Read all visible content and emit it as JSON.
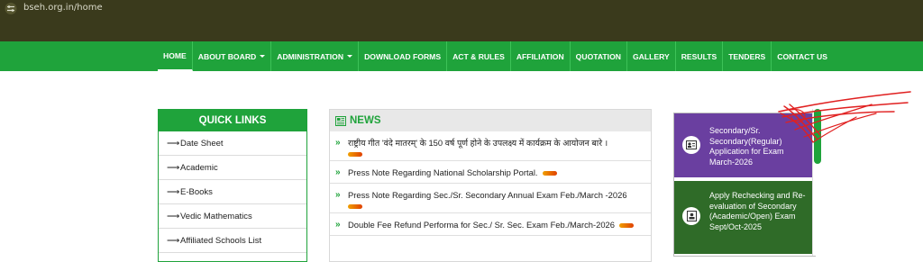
{
  "browser": {
    "url": "bseh.org.in/home"
  },
  "nav": {
    "items": [
      {
        "label": "HOME",
        "dropdown": false
      },
      {
        "label": "ABOUT BOARD",
        "dropdown": true
      },
      {
        "label": "ADMINISTRATION",
        "dropdown": true
      },
      {
        "label": "DOWNLOAD FORMS",
        "dropdown": false
      },
      {
        "label": "ACT & RULES",
        "dropdown": false
      },
      {
        "label": "AFFILIATION",
        "dropdown": false
      },
      {
        "label": "QUOTATION",
        "dropdown": false
      },
      {
        "label": "GALLERY",
        "dropdown": false
      },
      {
        "label": "RESULTS",
        "dropdown": false
      },
      {
        "label": "TENDERS",
        "dropdown": false
      },
      {
        "label": "CONTACT US",
        "dropdown": false
      }
    ]
  },
  "quick_links": {
    "title": "QUICK LINKS",
    "items": [
      {
        "label": "Date Sheet"
      },
      {
        "label": "Academic"
      },
      {
        "label": "E-Books"
      },
      {
        "label": "Vedic Mathematics"
      },
      {
        "label": "Affiliated Schools List"
      }
    ]
  },
  "news": {
    "title": "NEWS",
    "items": [
      {
        "text": "राष्ट्रीय गीत 'वंदे मातरम्' के 150 वर्ष पूर्ण होने के उपलक्ष्य में कार्यक्रम के आयोजन बारे ।"
      },
      {
        "text": "Press Note Regarding National Scholarship Portal."
      },
      {
        "text": "Press Note Regarding Sec./Sr. Secondary Annual Exam Feb./March -2026"
      },
      {
        "text": "Double Fee Refund Performa for Sec./ Sr. Sec. Exam Feb./March-2026"
      }
    ]
  },
  "right_panel": {
    "cards": [
      {
        "text": "Secondary/Sr. Secondary(Regular) Application for Exam March-2026"
      },
      {
        "text": "Apply Rechecking and Re-evaluation of Secondary (Academic/Open) Exam Sept/Oct-2025"
      }
    ]
  },
  "colors": {
    "nav_green": "#1fa33b",
    "top_bar": "#3a3a1c",
    "card_purple": "#6a3fa0",
    "card_green": "#2f6b28",
    "annotation_red": "#e02020"
  }
}
